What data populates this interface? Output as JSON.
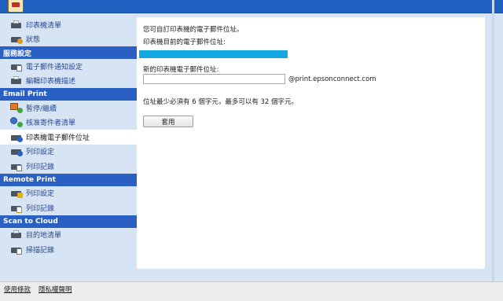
{
  "sidebar": {
    "top_items": [
      {
        "label": "印表機清單",
        "icon": "printer-list-icon"
      },
      {
        "label": "狀態",
        "icon": "status-icon"
      }
    ],
    "sections": [
      {
        "title": "服務設定",
        "items": [
          {
            "label": "電子郵件通知設定",
            "icon": "email-notification-icon"
          },
          {
            "label": "編輯印表機描述",
            "icon": "printer-edit-icon"
          }
        ]
      },
      {
        "title": "Email Print",
        "items": [
          {
            "label": "暫停/繼續",
            "icon": "pause-resume-icon"
          },
          {
            "label": "核准寄件者清單",
            "icon": "approved-senders-icon"
          },
          {
            "label": "印表機電子郵件位址",
            "icon": "printer-email-icon",
            "active": true
          },
          {
            "label": "列印設定",
            "icon": "print-settings-icon"
          },
          {
            "label": "列印記錄",
            "icon": "print-log-icon"
          }
        ]
      },
      {
        "title": "Remote Print",
        "items": [
          {
            "label": "列印設定",
            "icon": "remote-print-settings-icon"
          },
          {
            "label": "列印記錄",
            "icon": "remote-print-log-icon"
          }
        ]
      },
      {
        "title": "Scan to Cloud",
        "items": [
          {
            "label": "目的地清單",
            "icon": "destination-list-icon"
          },
          {
            "label": "掃描記錄",
            "icon": "scan-log-icon"
          }
        ]
      }
    ]
  },
  "main": {
    "intro": "您可自訂印表機的電子郵件位址。",
    "current_label": "印表機目前的電子郵件位址:",
    "current_value": "",
    "new_label": "新的印表機電子郵件位址:",
    "new_value": "",
    "domain_suffix": "@print.epsonconnect.com",
    "hint": "位址最少必須有 6 個字元，最多可以有 32 個字元。",
    "apply_label": "套用"
  },
  "footer": {
    "links": [
      "使用條款",
      "隱私權聲明"
    ]
  },
  "colors": {
    "header": "#1f5fbf",
    "section": "#2a60c4",
    "sidebar_bg": "#d7e4f4",
    "link": "#2a4a90",
    "current_email_box": "#13a8df"
  }
}
